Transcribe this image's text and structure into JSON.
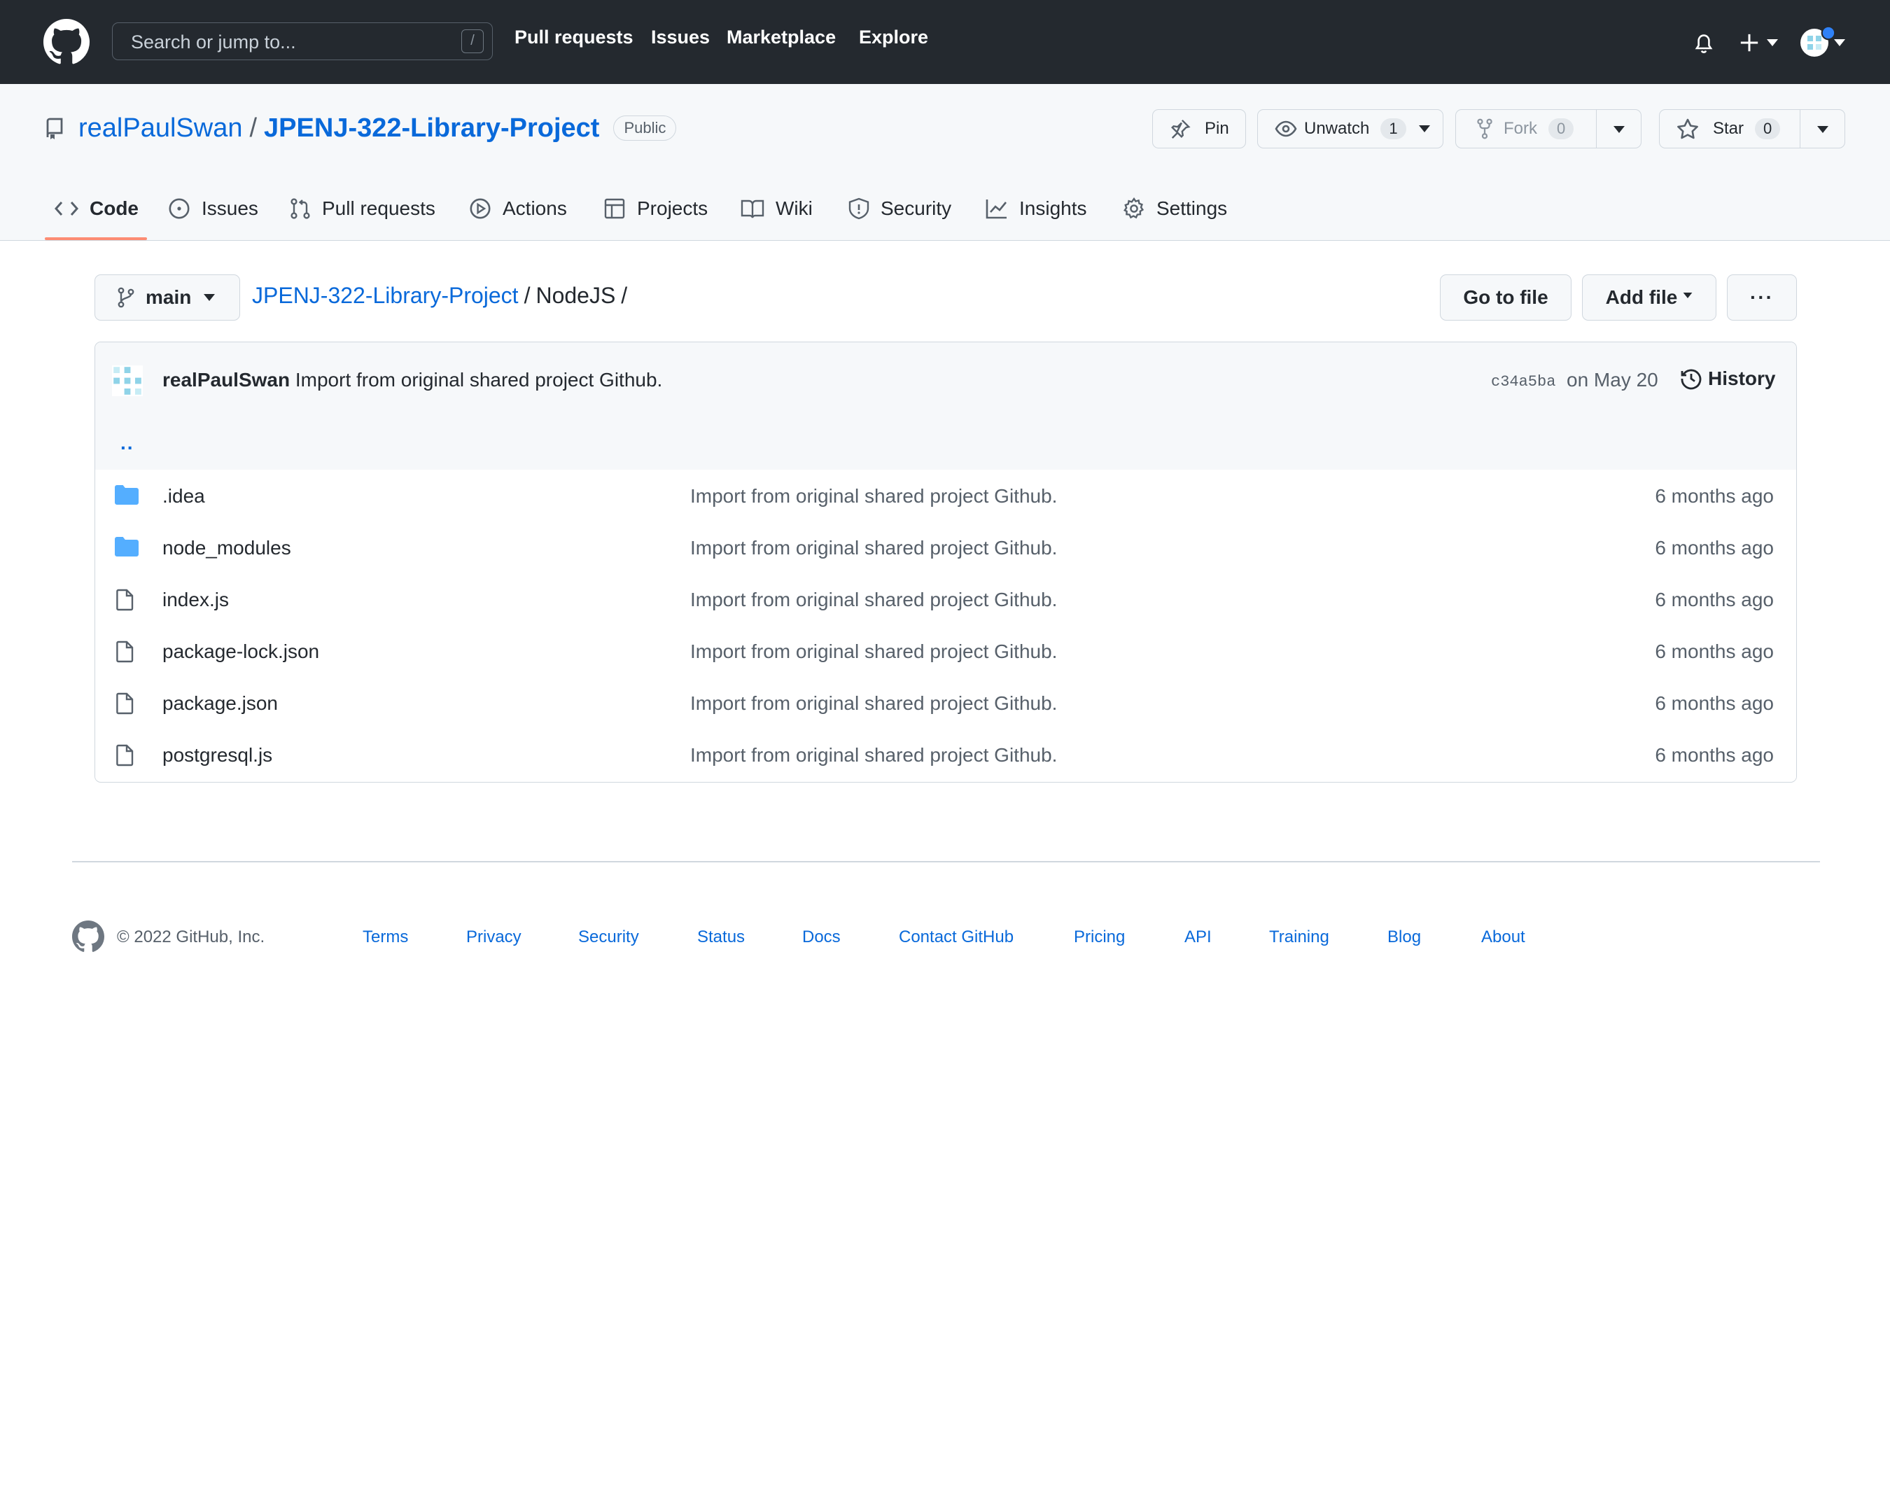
{
  "header": {
    "search_placeholder": "Search or jump to...",
    "search_shortcut": "/",
    "nav": [
      "Pull requests",
      "Issues",
      "Marketplace",
      "Explore"
    ]
  },
  "repo": {
    "owner": "realPaulSwan",
    "separator": "/",
    "name": "JPENJ-322-Library-Project",
    "visibility": "Public",
    "actions": {
      "pin": "Pin",
      "watch": "Unwatch",
      "watch_count": "1",
      "fork": "Fork",
      "fork_count": "0",
      "star": "Star",
      "star_count": "0"
    },
    "tabs": [
      {
        "label": "Code",
        "icon": "code-icon"
      },
      {
        "label": "Issues",
        "icon": "issue-icon"
      },
      {
        "label": "Pull requests",
        "icon": "pull-request-icon"
      },
      {
        "label": "Actions",
        "icon": "play-icon"
      },
      {
        "label": "Projects",
        "icon": "table-icon"
      },
      {
        "label": "Wiki",
        "icon": "book-icon"
      },
      {
        "label": "Security",
        "icon": "shield-icon"
      },
      {
        "label": "Insights",
        "icon": "graph-icon"
      },
      {
        "label": "Settings",
        "icon": "gear-icon"
      }
    ]
  },
  "path": {
    "branch": "main",
    "root": "JPENJ-322-Library-Project",
    "sep1": "/",
    "folder": "NodeJS",
    "sep2": "/"
  },
  "file_actions": {
    "go_to_file": "Go to file",
    "add_file": "Add file",
    "more": "···"
  },
  "latest_commit": {
    "author": "realPaulSwan",
    "message": "Import from original shared project Github.",
    "sha": "c34a5ba",
    "date": "on May 20",
    "history": "History"
  },
  "parent_dir": "..",
  "files": [
    {
      "name": ".idea",
      "type": "folder",
      "message": "Import from original shared project Github.",
      "age": "6 months ago"
    },
    {
      "name": "node_modules",
      "type": "folder",
      "message": "Import from original shared project Github.",
      "age": "6 months ago"
    },
    {
      "name": "index.js",
      "type": "file",
      "message": "Import from original shared project Github.",
      "age": "6 months ago"
    },
    {
      "name": "package-lock.json",
      "type": "file",
      "message": "Import from original shared project Github.",
      "age": "6 months ago"
    },
    {
      "name": "package.json",
      "type": "file",
      "message": "Import from original shared project Github.",
      "age": "6 months ago"
    },
    {
      "name": "postgresql.js",
      "type": "file",
      "message": "Import from original shared project Github.",
      "age": "6 months ago"
    }
  ],
  "footer": {
    "copyright": "© 2022 GitHub, Inc.",
    "links": [
      "Terms",
      "Privacy",
      "Security",
      "Status",
      "Docs",
      "Contact GitHub",
      "Pricing",
      "API",
      "Training",
      "Blog",
      "About"
    ]
  },
  "colors": {
    "header_bg": "#24292f",
    "link": "#0969da",
    "folder": "#54aeff",
    "tab_underline": "#fd8c73",
    "notification_dot": "#2f81f7"
  }
}
